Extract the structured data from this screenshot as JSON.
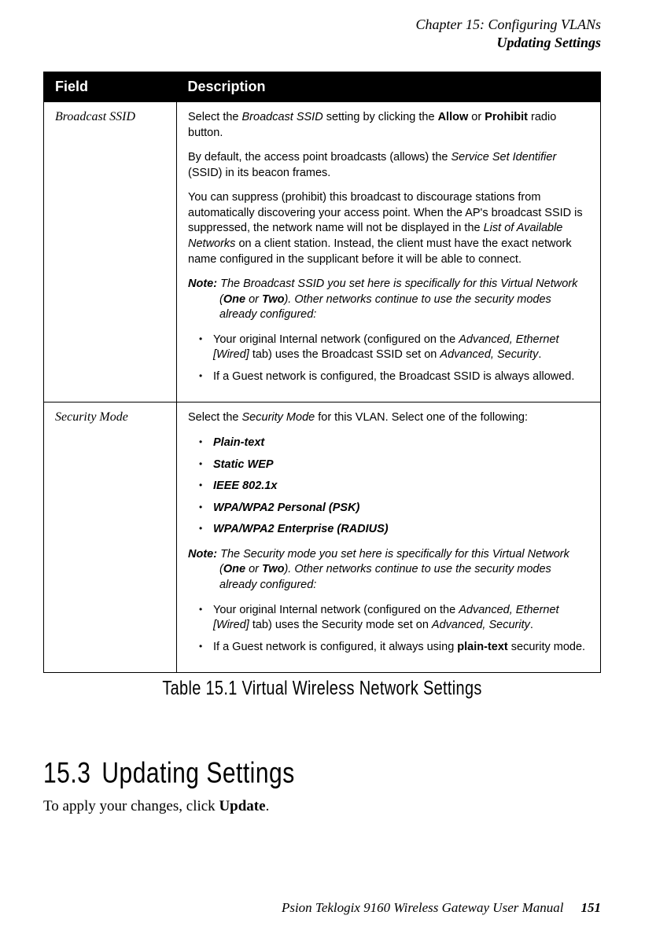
{
  "header": {
    "chapter": "Chapter 15:  Configuring VLANs",
    "section": "Updating Settings"
  },
  "table": {
    "headers": {
      "field": "Field",
      "desc": "Description"
    },
    "row1": {
      "name": "Broadcast SSID",
      "p1_a": "Select the ",
      "p1_b": "Broadcast SSID",
      "p1_c": " setting by clicking the ",
      "p1_d": "Allow",
      "p1_e": " or ",
      "p1_f": "Prohibit",
      "p1_g": " radio button.",
      "p2_a": "By default, the access point broadcasts (allows) the ",
      "p2_b": "Service Set Identifier",
      "p2_c": " (SSID) in its beacon frames.",
      "p3_a": "You can suppress (prohibit) this broadcast to discourage stations from automatically discovering your access point. When the AP's broadcast SSID is suppressed, the network name will not be displayed in the ",
      "p3_b": "List of Available Networks",
      "p3_c": " on a client station. Instead, the client must have the exact network name configured in the supplicant before it will be able to connect.",
      "note_label": "Note:",
      "note_a": " The Broadcast SSID you set here is specifically for this Virtual Network (",
      "note_b": "One",
      "note_c": " or ",
      "note_d": "Two",
      "note_e": "). Other networks continue to use the security modes already configured:",
      "li1_a": "Your original Internal network (configured on the ",
      "li1_b": "Advanced, Ethernet [Wired]",
      "li1_c": " tab) uses the Broadcast SSID set on ",
      "li1_d": "Advanced, Security",
      "li1_e": ".",
      "li2": "If a Guest network is configured, the Broadcast SSID is always allowed."
    },
    "row2": {
      "name": "Security Mode",
      "p1_a": "Select the ",
      "p1_b": "Security Mode",
      "p1_c": " for this VLAN. Select one of the following:",
      "opt1": "Plain-text",
      "opt2": "Static WEP",
      "opt3": "IEEE 802.1x",
      "opt4": "WPA/WPA2 Personal (PSK)",
      "opt5": "WPA/WPA2 Enterprise (RADIUS)",
      "note_label": "Note:",
      "note_a": " The Security mode you set here is specifically for this Virtual Network (",
      "note_b": "One",
      "note_c": " or ",
      "note_d": "Two",
      "note_e": "). Other networks continue to use the security modes already configured:",
      "li1_a": "Your original Internal network (configured on the ",
      "li1_b": "Advanced, Ethernet [Wired]",
      "li1_c": " tab) uses the Security mode set on ",
      "li1_d": "Advanced, Security",
      "li1_e": ".",
      "li2_a": "If a Guest network is configured, it always using ",
      "li2_b": "plain-text",
      "li2_c": " security mode."
    }
  },
  "caption": "Table 15.1 Virtual Wireless Network Settings",
  "section": {
    "number": "15.3",
    "title": "Updating Settings",
    "body_a": "To apply your changes, click ",
    "body_b": "Update",
    "body_c": "."
  },
  "footer": {
    "manual": "Psion Teklogix 9160 Wireless Gateway User Manual",
    "page": "151"
  }
}
